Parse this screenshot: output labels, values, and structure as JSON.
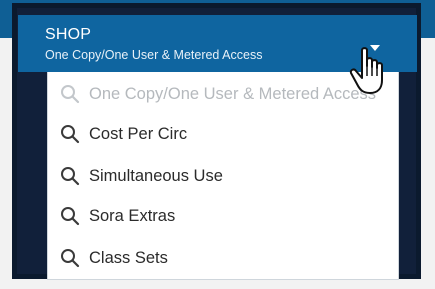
{
  "header": {
    "title": "SHOP",
    "subtitle": "One Copy/One User & Metered Access"
  },
  "menu": {
    "items": [
      {
        "label": "One Copy/One User & Metered Access",
        "dim": true
      },
      {
        "label": "Cost Per Circ"
      },
      {
        "label": "Simultaneous Use"
      },
      {
        "label": "Sora Extras"
      },
      {
        "label": "Class Sets"
      }
    ]
  },
  "icons": {
    "item_icon": "search-icon",
    "caret": "caret-down-icon",
    "pointer": "hand-pointer-icon"
  },
  "colors": {
    "header_bg": "#0f65a0",
    "frame": "#0b1a2e",
    "text": "#2b2b2b",
    "dim_text": "#b5b9bd"
  }
}
